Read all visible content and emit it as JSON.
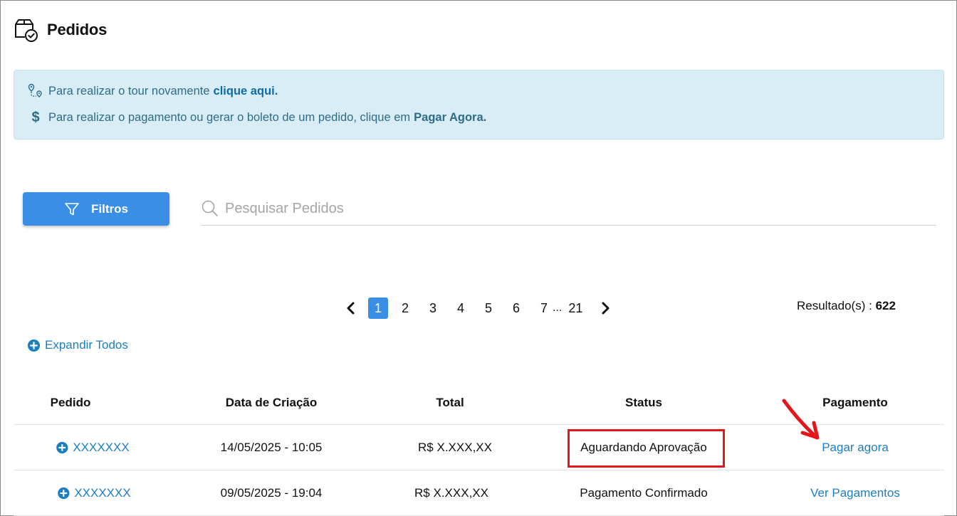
{
  "page": {
    "title": "Pedidos",
    "icon": "box-check-icon"
  },
  "info": {
    "tour_text": "Para realizar o tour novamente",
    "tour_link": "clique aqui.",
    "payment_text": "Para realizar o pagamento ou gerar o boleto de um pedido, clique em",
    "payment_link": "Pagar Agora."
  },
  "toolbar": {
    "filter_label": "Filtros",
    "search_placeholder": "Pesquisar Pedidos"
  },
  "pagination": {
    "pages": [
      "1",
      "2",
      "3",
      "4",
      "5",
      "6",
      "7"
    ],
    "current": "1",
    "ellipsis": "...",
    "last": "21"
  },
  "results": {
    "label": "Resultado(s) :",
    "count": "622"
  },
  "expand_all_label": "Expandir Todos",
  "table": {
    "headers": [
      "Pedido",
      "Data de Criação",
      "Total",
      "Status",
      "Pagamento"
    ],
    "rows": [
      {
        "pedido": "XXXXXXX",
        "data": "14/05/2025 - 10:05",
        "total": "R$ X.XXX,XX",
        "status": "Aguardando Aprovação",
        "pagamento": "Pagar agora"
      },
      {
        "pedido": "XXXXXXX",
        "data": "09/05/2025 - 19:04",
        "total": "R$ X.XXX,XX",
        "status": "Pagamento Confirmado",
        "pagamento": "Ver Pagamentos"
      }
    ]
  },
  "colors": {
    "accent": "#3a8ee6",
    "link": "#1b7ec2",
    "info_bg": "#d9edf6",
    "annotation": "#e3161c"
  }
}
